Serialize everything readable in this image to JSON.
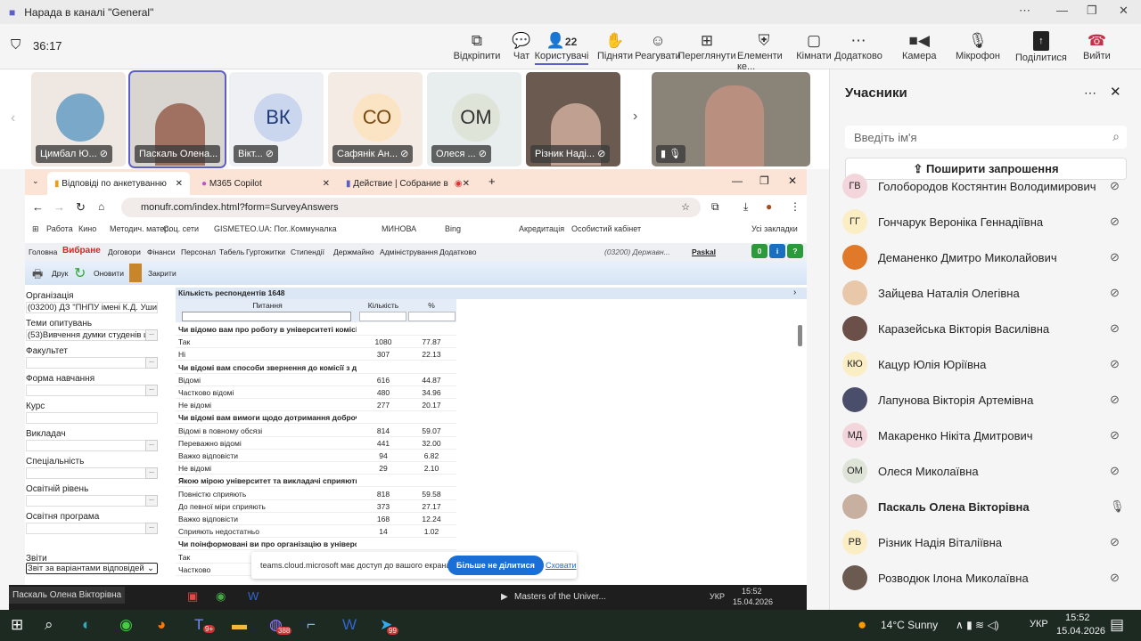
{
  "window": {
    "title": "Нарада в каналі \"General\""
  },
  "meeting": {
    "timer": "36:17",
    "toolbar": [
      {
        "icon": "pop-out-icon",
        "label": "Відкріпити",
        "glyph": "⧉"
      },
      {
        "icon": "chat-icon",
        "label": "Чат",
        "glyph": "💬"
      },
      {
        "icon": "people-icon",
        "label": "Користувачі",
        "glyph": "👤",
        "count": "22"
      },
      {
        "icon": "raise-hand-icon",
        "label": "Підняти",
        "glyph": "✋"
      },
      {
        "icon": "react-icon",
        "label": "Реагувати",
        "glyph": "☺"
      },
      {
        "icon": "view-icon",
        "label": "Переглянути",
        "glyph": "⊞"
      },
      {
        "icon": "shield-icon",
        "label": "Елементи ке...",
        "glyph": "⛨"
      },
      {
        "icon": "rooms-icon",
        "label": "Кімнати",
        "glyph": "▢"
      },
      {
        "icon": "more-icon",
        "label": "Додатково",
        "glyph": "⋯"
      }
    ],
    "camera": "Камера",
    "mic": "Мікрофон",
    "share": "Поділитися",
    "leave": "Вийти"
  },
  "tiles": [
    {
      "name": "Цимбал Ю...",
      "initials": "",
      "bg": "#efe8e2"
    },
    {
      "name": "Паскаль Олена...",
      "initials": "",
      "bg": "#d9d6d2"
    },
    {
      "name": "Вікт...",
      "initials": "ВК",
      "bg": "#eef0f4",
      "avbg": "#c9d6ee",
      "fg": "#1e3a7a"
    },
    {
      "name": "Сафянік Ан...",
      "initials": "СО",
      "bg": "#f4ece4",
      "avbg": "#fbe4c4",
      "fg": "#7a4a10"
    },
    {
      "name": "Олеся ...",
      "initials": "ОМ",
      "bg": "#e8eeee",
      "avbg": "#dfe4d8",
      "fg": "#333"
    },
    {
      "name": "Різник Наді...",
      "initials": "",
      "bg": "#6b5a50"
    }
  ],
  "participants": {
    "title": "Учасники",
    "search_placeholder": "Введіть ім'я",
    "invite": "Поширити запрошення",
    "list": [
      {
        "initials": "ГВ",
        "name": "Голобородов Костянтин Володимирович",
        "bg": "#f3d6dc",
        "muted": true
      },
      {
        "initials": "ГГ",
        "name": "Гончарук Вероніка Геннадіївна",
        "bg": "#fbeec4",
        "muted": true
      },
      {
        "initials": "",
        "name": "Деманенко Дмитро Миколайович",
        "bg": "#e07a2a",
        "muted": true
      },
      {
        "initials": "",
        "name": "Зайцева Наталія Олегівна",
        "bg": "#e8c8a8",
        "muted": true
      },
      {
        "initials": "",
        "name": "Каразейська Вікторія Василівна",
        "bg": "#6a5048",
        "muted": true
      },
      {
        "initials": "КЮ",
        "name": "Кацур Юлія Юріївна",
        "bg": "#fbeec4",
        "muted": true
      },
      {
        "initials": "",
        "name": "Лапунова Вікторія Артемівна",
        "bg": "#4a4e6a",
        "muted": true
      },
      {
        "initials": "МД",
        "name": "Макаренко Нікіта Дмитрович",
        "bg": "#f3d6dc",
        "muted": true
      },
      {
        "initials": "ОМ",
        "name": "Олеся Миколаївна",
        "bg": "#dfe4d8",
        "muted": true
      },
      {
        "initials": "",
        "name": "Паскаль Олена Вікторівна",
        "bg": "#c8b0a0",
        "muted": false,
        "bold": true
      },
      {
        "initials": "РВ",
        "name": "Різник Надія Віталіївна",
        "bg": "#fbeec4",
        "muted": true
      },
      {
        "initials": "",
        "name": "Розводюк Ілона Миколаївна",
        "bg": "#6a5a50",
        "muted": true
      }
    ]
  },
  "browser": {
    "tabs": [
      "Відповіді по анкетуванню",
      "M365 Copilot",
      "Действие | Собрание в ка..."
    ],
    "url": "monufr.com/index.html?form=SurveyAnswers",
    "bookmarks": [
      "Работа",
      "Кино",
      "Методич. матер.",
      "Соц. сети",
      "GISMETEO.UA: Пог...",
      "Коммуналка",
      "МИНОВА",
      "Bing",
      "Акредитація",
      "Особистий кабінет",
      "Усі закладки"
    ]
  },
  "app": {
    "menu": [
      "Головна",
      "Вибране",
      "Договори",
      "Фінанси",
      "Персонал",
      "Табель",
      "Гуртожитки",
      "Стипендії",
      "Держмайно",
      "Адміністрування",
      "Додатково"
    ],
    "org_short": "(03200) Державн...",
    "user": "Paskal",
    "badges": [
      "0",
      "i",
      "?"
    ],
    "tools": [
      "Друк",
      "Оновити",
      "Закрити"
    ],
    "filters": [
      {
        "label": "Організація",
        "value": "(03200) ДЗ \"ПНПУ імені К.Д. Ушинсь"
      },
      {
        "label": "Теми опитувань",
        "value": "(53)Вивчення думки студенів що"
      },
      {
        "label": "Факультет",
        "value": ""
      },
      {
        "label": "Форма навчання",
        "value": ""
      },
      {
        "label": "Курс",
        "value": ""
      },
      {
        "label": "Викладач",
        "value": ""
      },
      {
        "label": "Спеціальність",
        "value": ""
      },
      {
        "label": "Освітній рівень",
        "value": ""
      },
      {
        "label": "Освітня програма",
        "value": ""
      }
    ],
    "reports_label": "Звіти",
    "reports_value": "Звіт за варіантами відповідей",
    "respondents": "Кількість респондентів 1648",
    "columns": [
      "Питання",
      "Кількість",
      "%"
    ],
    "rows": [
      {
        "q": "Чи відомо вам про роботу в університеті комісії з д",
        "b": true
      },
      {
        "q": "Так",
        "c": "1080",
        "p": "77.87"
      },
      {
        "q": "Ні",
        "c": "307",
        "p": "22.13"
      },
      {
        "q": "Чи відомі вам способи звернення до комісії з добро",
        "b": true
      },
      {
        "q": "Відомі",
        "c": "616",
        "p": "44.87"
      },
      {
        "q": "Частково відомі",
        "c": "480",
        "p": "34.96"
      },
      {
        "q": "Не відомі",
        "c": "277",
        "p": "20.17"
      },
      {
        "q": "Чи відомі вам вимоги щодо дотримання доброчесн",
        "b": true
      },
      {
        "q": "Відомі в повному обсязі",
        "c": "814",
        "p": "59.07"
      },
      {
        "q": "Переважно відомі",
        "c": "441",
        "p": "32.00"
      },
      {
        "q": "Важко відповісти",
        "c": "94",
        "p": "6.82"
      },
      {
        "q": "Не відомі",
        "c": "29",
        "p": "2.10"
      },
      {
        "q": "Якою мірою університет та викладачі сприяють по",
        "b": true
      },
      {
        "q": "Повністю сприяють",
        "c": "818",
        "p": "59.58"
      },
      {
        "q": "До певної міри сприяють",
        "c": "373",
        "p": "27.17"
      },
      {
        "q": "Важко відповісти",
        "c": "168",
        "p": "12.24"
      },
      {
        "q": "Сприяють недостатньо",
        "c": "14",
        "p": "1.02"
      },
      {
        "q": "Чи поінформовані ви про організацію в університет",
        "b": true
      },
      {
        "q": "Так"
      },
      {
        "q": "Частково"
      }
    ]
  },
  "share_bar": {
    "text": "teams.cloud.microsoft має доступ до вашого екрана.",
    "stop": "Більше не ділитися",
    "hide": "Сховати"
  },
  "inner_taskbar": {
    "presenter": "Паскаль Олена Вікторівна",
    "media": "Masters of the Univer...",
    "lang": "УКР",
    "time": "15:52",
    "date": "15.04.2026"
  },
  "taskbar": {
    "weather": "14°C Sunny",
    "lang": "УКР",
    "time": "15:52",
    "date": "15.04.2026",
    "badges": [
      "9+",
      "388",
      "99"
    ]
  }
}
